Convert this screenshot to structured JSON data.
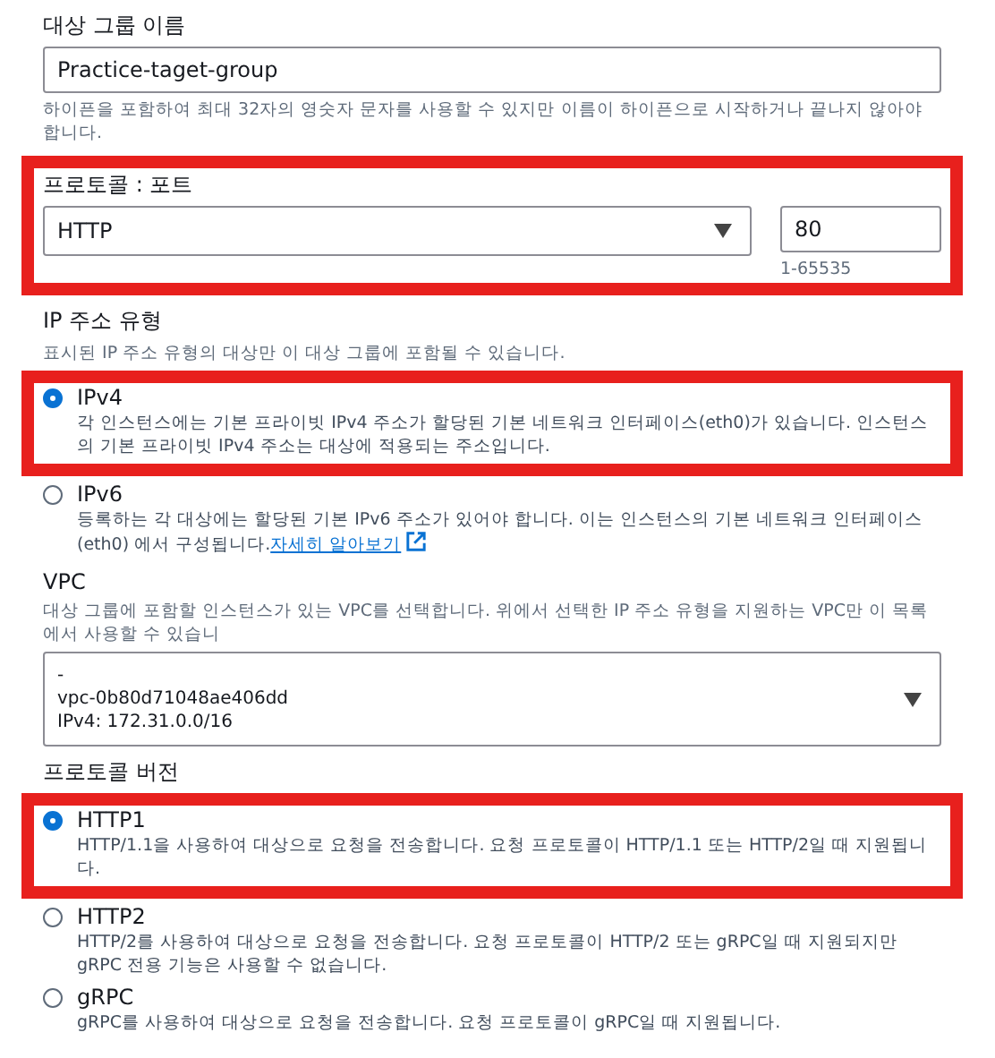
{
  "target_group_name": {
    "label": "대상 그룹 이름",
    "value": "Practice-taget-group",
    "hint": "하이픈을 포함하여 최대 32자의 영숫자 문자를 사용할 수 있지만 이름이 하이픈으로 시작하거나 끝나지 않아야 합니다."
  },
  "protocol_port": {
    "label": "프로토콜 : 포트",
    "highlighted": true,
    "protocol": "HTTP",
    "port": "80",
    "port_hint": "1-65535"
  },
  "ip_address_type": {
    "label": "IP 주소 유형",
    "hint": "표시된 IP 주소 유형의 대상만 이 대상 그룹에 포함될 수 있습니다.",
    "options": [
      {
        "label": "IPv4",
        "selected": true,
        "highlighted": true,
        "description": "각 인스턴스에는 기본 프라이빗 IPv4 주소가 할당된 기본 네트워크 인터페이스(eth0)가 있습니다. 인스턴스의 기본 프라이빗 IPv4 주소는 대상에 적용되는 주소입니다."
      },
      {
        "label": "IPv6",
        "selected": false,
        "highlighted": false,
        "description": "등록하는 각 대상에는 할당된 기본 IPv6 주소가 있어야 합니다. 이는 인스턴스의 기본 네트워크 인터페이스(eth0) 에서 구성됩니다.",
        "link": "자세히 알아보기"
      }
    ]
  },
  "vpc": {
    "label": "VPC",
    "hint": "대상 그룹에 포함할 인스턴스가 있는 VPC를 선택합니다. 위에서 선택한 IP 주소 유형을 지원하는 VPC만 이 목록에서 사용할 수 있습니",
    "selected_lines": [
      "-",
      "vpc-0b80d71048ae406dd",
      "IPv4: 172.31.0.0/16"
    ]
  },
  "protocol_version": {
    "label": "프로토콜 버전",
    "options": [
      {
        "label": "HTTP1",
        "selected": true,
        "highlighted": true,
        "description": "HTTP/1.1을 사용하여 대상으로 요청을 전송합니다. 요청 프로토콜이 HTTP/1.1 또는 HTTP/2일 때 지원됩니다."
      },
      {
        "label": "HTTP2",
        "selected": false,
        "highlighted": false,
        "description": "HTTP/2를 사용하여 대상으로 요청을 전송합니다. 요청 프로토콜이 HTTP/2 또는 gRPC일 때 지원되지만 gRPC 전용 기능은 사용할 수 없습니다."
      },
      {
        "label": "gRPC",
        "selected": false,
        "highlighted": false,
        "description": "gRPC를 사용하여 대상으로 요청을 전송합니다. 요청 프로토콜이 gRPC일 때 지원됩니다."
      }
    ]
  }
}
